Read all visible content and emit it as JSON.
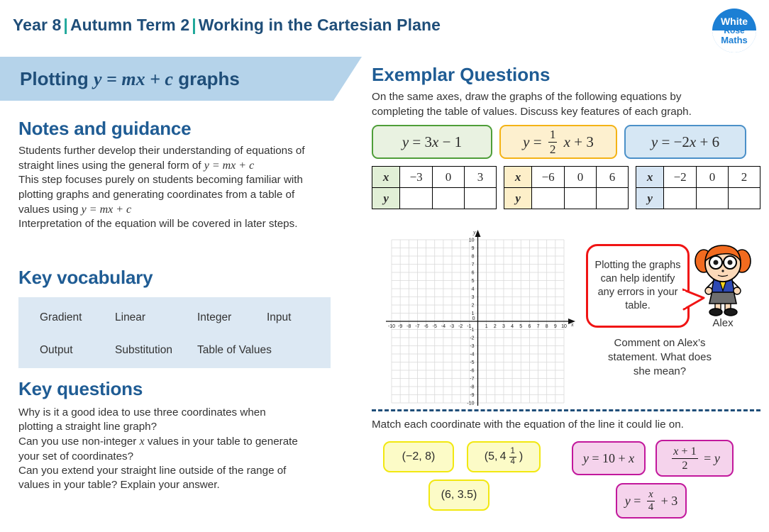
{
  "header": {
    "year": "Year 8",
    "term": "Autumn Term 2",
    "topic": "Working in the Cartesian Plane",
    "separator": "|",
    "logo": {
      "line1": "White",
      "line2": "Rose",
      "line3": "Maths"
    }
  },
  "banner": {
    "title_prefix": "Plotting ",
    "title_math": "y = mx + c",
    "title_suffix": " graphs"
  },
  "notes": {
    "heading": "Notes and guidance",
    "line1": "Students further develop their understanding of equations of",
    "line2_pre": "straight lines using the general form of ",
    "line2_math": "y = mx + c",
    "line3": "This step focuses purely on students becoming familiar with",
    "line4": "plotting graphs and generating coordinates from a table of",
    "line5_pre": "values using ",
    "line5_math": "y = mx + c",
    "line6": "Interpretation of the equation will be covered in later steps."
  },
  "vocabulary": {
    "heading": "Key vocabulary",
    "row1": [
      "Gradient",
      "Linear",
      "Integer",
      "Input"
    ],
    "row2": [
      "Output",
      "Substitution",
      "Table of Values"
    ]
  },
  "questions": {
    "heading": "Key questions",
    "line1": "Why is it a good idea to use three coordinates when",
    "line2": "plotting a straight line graph?",
    "line3_pre": "Can you use non-integer ",
    "line3_math": "x",
    "line3_post": " values in your table to generate",
    "line4": "your set of coordinates?",
    "line5": "Can you extend your straight line outside of the range of",
    "line6": "values in your table? Explain your answer."
  },
  "exemplar": {
    "heading": "Exemplar Questions",
    "intro_line1": "On the same axes, draw the graphs of the following equations by",
    "intro_line2": "completing the table of values. Discuss key features of each graph.",
    "equations": [
      {
        "label": "y = 3x − 1",
        "color": "#4F9E39",
        "fill": "#E9F2E1"
      },
      {
        "label": "y = 1/2 x + 3",
        "color": "#F4B316",
        "fill": "#FDF0CF"
      },
      {
        "label": "y = −2x + 6",
        "color": "#4B90C8",
        "fill": "#D6E7F4"
      }
    ],
    "tables": [
      {
        "header_x": "x",
        "header_y": "y",
        "x_values": [
          "−3",
          "0",
          "3"
        ],
        "y_values": [
          "",
          "",
          ""
        ]
      },
      {
        "header_x": "x",
        "header_y": "y",
        "x_values": [
          "−6",
          "0",
          "6"
        ],
        "y_values": [
          "",
          "",
          ""
        ]
      },
      {
        "header_x": "x",
        "header_y": "y",
        "x_values": [
          "−2",
          "0",
          "2"
        ],
        "y_values": [
          "",
          "",
          ""
        ]
      }
    ]
  },
  "chart_data": {
    "type": "scatter",
    "title": "",
    "xlabel": "x",
    "ylabel": "y",
    "xlim": [
      -10,
      10
    ],
    "ylim": [
      -10,
      10
    ],
    "xticks": [
      -10,
      -9,
      -8,
      -7,
      -6,
      -5,
      -4,
      -3,
      -2,
      -1,
      1,
      2,
      3,
      4,
      5,
      6,
      7,
      8,
      9,
      10
    ],
    "yticks": [
      -10,
      -9,
      -8,
      -7,
      -6,
      -5,
      -4,
      -3,
      -2,
      -1,
      1,
      2,
      3,
      4,
      5,
      6,
      7,
      8,
      9,
      10
    ],
    "grid": true,
    "legend": "none",
    "series": []
  },
  "alex": {
    "bubble_text": "Plotting the graphs can help identify any errors in your table.",
    "name": "Alex",
    "prompt_line1": "Comment on Alex’s",
    "prompt_line2": "statement. What does",
    "prompt_line3": "she mean?",
    "bubble_border": "#F01414"
  },
  "matching": {
    "instruction": "Match each coordinate with the equation of the line it could lie on.",
    "coordinates": [
      "(−2, 8)",
      "(5, 4 1/4)",
      "(6, 3.5)"
    ],
    "equations": [
      "y = 10 + x",
      "(x + 1)/2 = y",
      "y = x/4 + 3"
    ],
    "coordinate_color": "#F2E811",
    "equation_color": "#C2189C"
  }
}
